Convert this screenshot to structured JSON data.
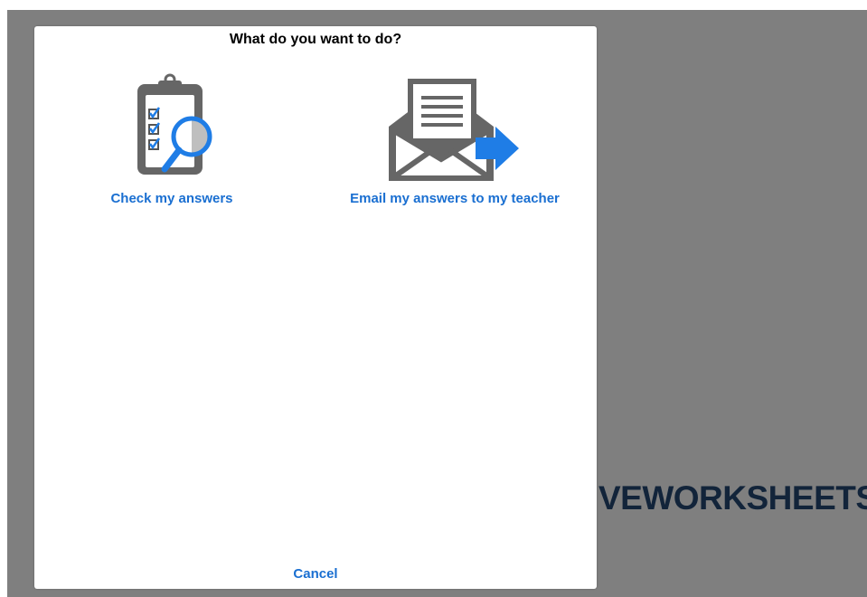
{
  "background_brand": "VEWORKSHEETS",
  "dialog": {
    "title": "What do you want to do?",
    "options": [
      {
        "label": "Check my answers",
        "icon": "clipboard-magnifier-icon"
      },
      {
        "label": "Email my answers to my teacher",
        "icon": "envelope-arrow-icon"
      }
    ],
    "cancel_label": "Cancel"
  },
  "colors": {
    "overlay": "#7f7f7f",
    "link": "#1a6fd1",
    "icon_gray": "#666666",
    "icon_blue": "#1f7de6",
    "brand": "#12243a"
  }
}
